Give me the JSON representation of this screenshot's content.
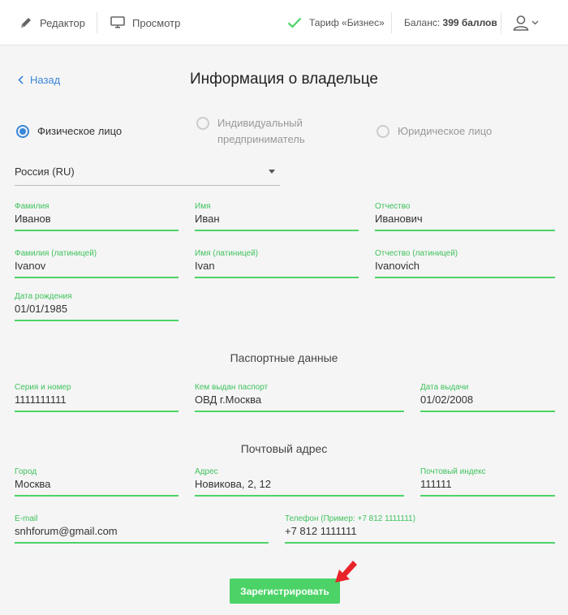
{
  "topbar": {
    "editor_label": "Редактор",
    "preview_label": "Просмотр",
    "tariff_label": "Тариф «Бизнес»",
    "balance_prefix": "Баланс:",
    "balance_value": "399 баллов"
  },
  "back_label": "Назад",
  "page_title": "Информация о владельце",
  "owner_types": [
    {
      "label": "Физическое лицо",
      "selected": true
    },
    {
      "label_line1": "Индивидуальный",
      "label_line2": "предприниматель",
      "selected": false
    },
    {
      "label": "Юридическое лицо",
      "selected": false
    }
  ],
  "country": "Россия (RU)",
  "personal": {
    "last_name": {
      "label": "Фамилия",
      "value": "Иванов"
    },
    "first_name": {
      "label": "Имя",
      "value": "Иван"
    },
    "patronymic": {
      "label": "Отчество",
      "value": "Иванович"
    },
    "last_name_lat": {
      "label": "Фамилия (латиницей)",
      "value": "Ivanov"
    },
    "first_name_lat": {
      "label": "Имя (латиницей)",
      "value": "Ivan"
    },
    "patronymic_lat": {
      "label": "Отчество (латиницей)",
      "value": "Ivanovich"
    },
    "birth_date": {
      "label": "Дата рождения",
      "value": "01/01/1985"
    }
  },
  "passport": {
    "title": "Паспортные данные",
    "series": {
      "label": "Серия и номер",
      "value": "1111111111"
    },
    "issued_by": {
      "label": "Кем выдан паспорт",
      "value": "ОВД г.Москва"
    },
    "issue_date": {
      "label": "Дата выдачи",
      "value": "01/02/2008"
    }
  },
  "address": {
    "title": "Почтовый адрес",
    "city": {
      "label": "Город",
      "value": "Москва"
    },
    "street": {
      "label": "Адрес",
      "value": "Новикова, 2, 12"
    },
    "zip": {
      "label": "Почтовый индекс",
      "value": "111111"
    },
    "email": {
      "label": "E-mail",
      "value": "snhforum@gmail.com"
    },
    "phone": {
      "label": "Телефон (Пример: +7 812 1111111)",
      "value": "+7 812 1111111"
    }
  },
  "submit_label": "Зарегистрировать",
  "colors": {
    "accent_green": "#4cd367",
    "link_blue": "#3a86d8",
    "arrow_red": "#e8232a"
  }
}
